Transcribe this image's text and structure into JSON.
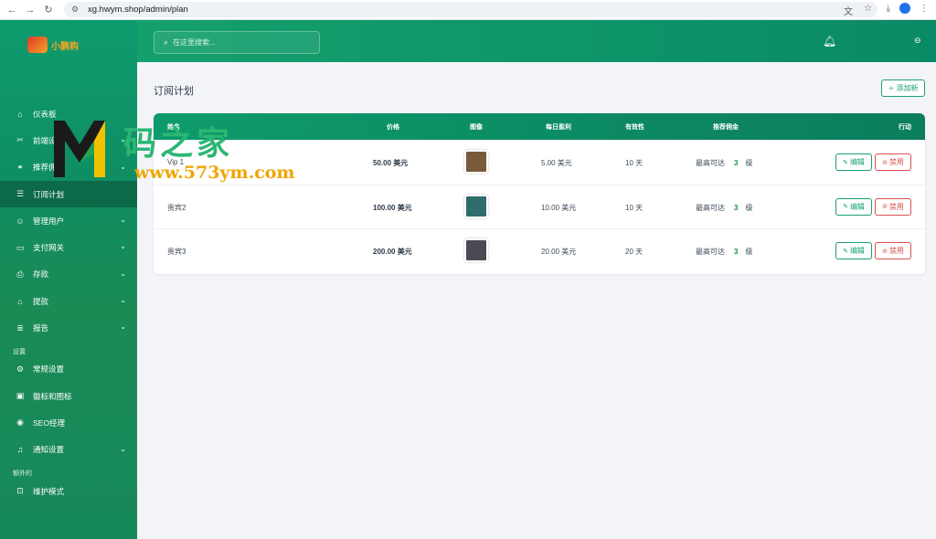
{
  "browser": {
    "url": "xg.hwym.shop/admin/plan"
  },
  "brand": {
    "logo_text": "小鹏购"
  },
  "search": {
    "placeholder": "在这里搜索..."
  },
  "sidebar": {
    "items": [
      {
        "label": "仪表板",
        "icon": "home-icon",
        "chevron": false,
        "active": false
      },
      {
        "label": "前端设置",
        "icon": "tools-icon",
        "chevron": true,
        "active": false
      },
      {
        "label": "推荐佣金",
        "icon": "link-icon",
        "chevron": true,
        "active": false
      },
      {
        "label": "订阅计划",
        "icon": "list-icon",
        "chevron": false,
        "active": true
      },
      {
        "label": "管理用户",
        "icon": "users-icon",
        "chevron": true,
        "active": false
      },
      {
        "label": "支付网关",
        "icon": "card-icon",
        "chevron": true,
        "active": false
      },
      {
        "label": "存款",
        "icon": "deposit-icon",
        "chevron": true,
        "active": false
      },
      {
        "label": "提款",
        "icon": "bank-icon",
        "chevron": true,
        "active": false
      },
      {
        "label": "报告",
        "icon": "report-icon",
        "chevron": true,
        "active": false
      }
    ],
    "section_settings": "设置",
    "settings_items": [
      {
        "label": "常规设置",
        "icon": "gear-icon",
        "chevron": false
      },
      {
        "label": "徽标和图标",
        "icon": "image-icon",
        "chevron": false
      },
      {
        "label": "SEO经理",
        "icon": "globe-icon",
        "chevron": false
      },
      {
        "label": "通知设置",
        "icon": "bell-icon",
        "chevron": true
      }
    ],
    "section_extra": "额外的",
    "extra_items": [
      {
        "label": "维护模式",
        "icon": "robot-icon",
        "chevron": false
      }
    ]
  },
  "page": {
    "title": "订阅计划",
    "add_button": "添加新"
  },
  "table": {
    "headers": {
      "name": "姓名",
      "price": "价格",
      "image": "图像",
      "daily_profit": "每日盈利",
      "validity": "有效性",
      "referral": "推荐佣金",
      "action": "行动"
    },
    "rows": [
      {
        "name": "Vip 1",
        "price": "50.00 美元",
        "daily_profit": "5.00 美元",
        "validity": "10 天",
        "ref_prefix": "最高可达",
        "ref_level": "3",
        "ref_suffix": "级",
        "image_color": "#7a5a3a"
      },
      {
        "name": "贵宾2",
        "price": "100.00 美元",
        "daily_profit": "10.00 美元",
        "validity": "10 天",
        "ref_prefix": "最高可达",
        "ref_level": "3",
        "ref_suffix": "级",
        "image_color": "#2f6d6a"
      },
      {
        "name": "贵宾3",
        "price": "200.00 美元",
        "daily_profit": "20.00 美元",
        "validity": "20 天",
        "ref_prefix": "最高可达",
        "ref_level": "3",
        "ref_suffix": "级",
        "image_color": "#4a4a52"
      }
    ],
    "edit_label": "编辑",
    "disable_label": "禁用"
  },
  "watermark": {
    "text": "码之家",
    "url": "www.573ym.com"
  },
  "colors": {
    "accent": "#1aa071",
    "danger": "#d9534f",
    "sidebar_active": "rgba(0,0,0,0.25)"
  }
}
